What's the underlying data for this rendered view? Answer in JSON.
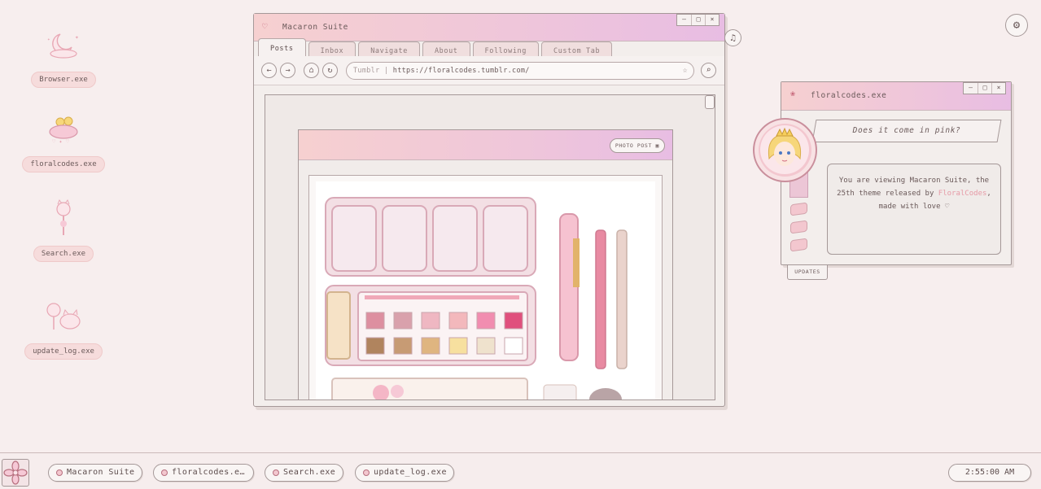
{
  "desktop": {
    "icons": [
      {
        "label": "Browser.exe",
        "icon": "moon-cloud-icon"
      },
      {
        "label": "floralcodes.exe",
        "icon": "flower-cloud-icon"
      },
      {
        "label": "Search.exe",
        "icon": "cat-flower-icon"
      },
      {
        "label": "update_log.exe",
        "icon": "cat-lamp-icon"
      }
    ]
  },
  "browser": {
    "title": "Macaron Suite",
    "tabs": [
      "Posts",
      "Inbox",
      "Navigate",
      "About",
      "Following",
      "Custom Tab"
    ],
    "active_tab": "Posts",
    "url_prefix": "Tumblr",
    "url": "https://floralcodes.tumblr.com/",
    "post_badge": "PHOTO POST",
    "window_controls": [
      "–",
      "□",
      "×"
    ]
  },
  "widget": {
    "title": "floralcodes.exe",
    "quote": "Does it come in pink?",
    "info_line1": "You are viewing Macaron Suite, the 25th theme released by",
    "info_link": "FloralCodes",
    "info_line2": ", made with love ♡",
    "updates_label": "UPDATES"
  },
  "taskbar": {
    "tasks": [
      "Macaron Suite",
      "floralcodes.e…",
      "Search.exe",
      "update_log.exe"
    ],
    "clock": "2:55:00 AM"
  },
  "colors": {
    "background": "#f7eeee",
    "accent_pink": "#f3c7cf",
    "gradient_start": "#f6d0d0",
    "gradient_end": "#e8bde3",
    "link": "#e69aa6"
  }
}
